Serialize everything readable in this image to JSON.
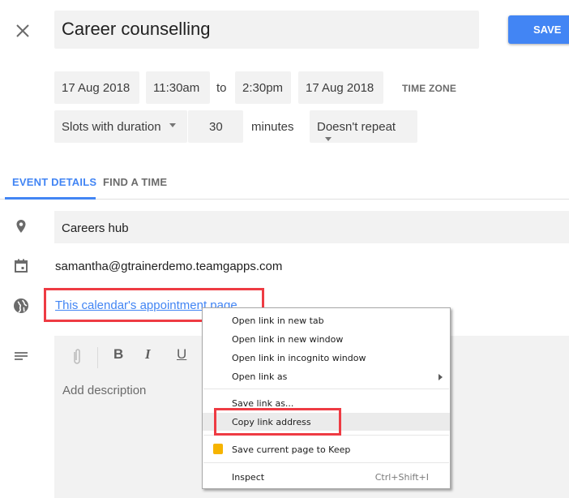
{
  "header": {
    "title_value": "Career counselling",
    "save_label": "SAVE",
    "close_icon": "close-icon"
  },
  "datetime": {
    "start_date": "17 Aug 2018",
    "start_time": "11:30am",
    "to_label": "to",
    "end_time": "2:30pm",
    "end_date": "17 Aug 2018",
    "time_zone_label": "TIME ZONE"
  },
  "slots": {
    "mode": "Slots with duration",
    "duration": "30",
    "unit_label": "minutes",
    "repeat": "Doesn't repeat"
  },
  "tabs": [
    {
      "label": "EVENT DETAILS",
      "active": true
    },
    {
      "label": "FIND A TIME",
      "active": false
    }
  ],
  "details": {
    "location": "Careers hub",
    "calendar_owner": "samantha@gtrainerdemo.teamgapps.com",
    "appointment_link": "This calendar's appointment page",
    "description_placeholder": "Add description",
    "toolbar": {
      "bold": "B",
      "italic": "I",
      "underline": "U"
    }
  },
  "context_menu": {
    "items": [
      {
        "label": "Open link in new tab"
      },
      {
        "label": "Open link in new window"
      },
      {
        "label": "Open link in incognito window"
      },
      {
        "label": "Open link as",
        "submenu": true
      },
      {
        "label": "Save link as..."
      },
      {
        "label": "Copy link address",
        "highlighted": true
      },
      {
        "label": "Save current page to Keep",
        "icon": "keep-icon"
      },
      {
        "label": "Inspect",
        "shortcut": "Ctrl+Shift+I"
      }
    ]
  },
  "colors": {
    "accent": "#4285f4",
    "annotation_red": "#ee3b43",
    "field_bg": "#f2f2f2",
    "keep_yellow": "#f6b400"
  }
}
